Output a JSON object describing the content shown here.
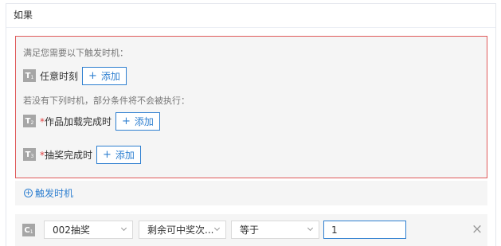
{
  "panel": {
    "title": "如果"
  },
  "triggers": {
    "hint_any": "满足您需要以下触发时机：",
    "hint_required": "若没有下列时机，部分条件将不会被执行：",
    "items": [
      {
        "badge": "T",
        "sub": "1",
        "required": false,
        "label": "任意时刻",
        "add_label": "添加"
      },
      {
        "badge": "T",
        "sub": "2",
        "required": true,
        "label": "作品加载完成时",
        "add_label": "添加"
      },
      {
        "badge": "T",
        "sub": "3",
        "required": true,
        "label": "抽奖完成时",
        "add_label": "添加"
      }
    ],
    "required_mark": "*",
    "add_icon": "plus-icon",
    "add_trigger_link": "触发时机",
    "border_color": "#e05a5a",
    "accent_color": "#2e7fd0"
  },
  "condition": {
    "badge": "C",
    "sub": "1",
    "target": "002抽奖",
    "property": "剩余可中奖次...",
    "operator": "等于",
    "value": "1",
    "remove_icon": "close-icon"
  }
}
